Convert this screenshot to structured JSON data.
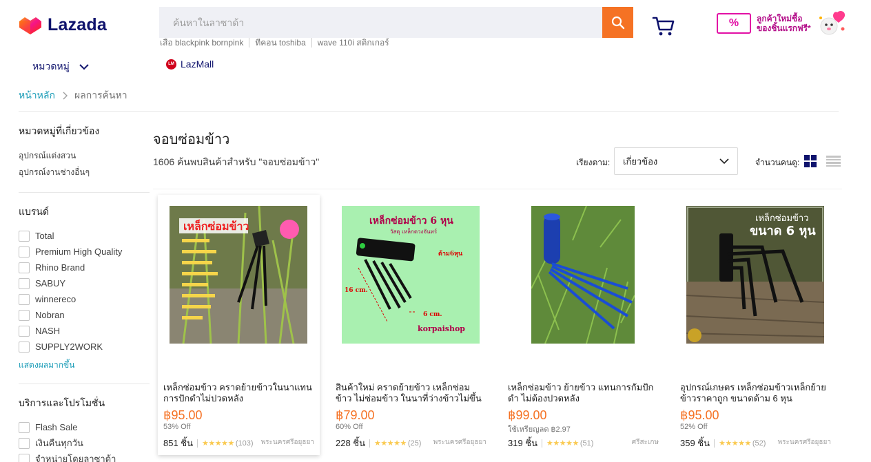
{
  "header": {
    "logo_text": "Lazada",
    "search_placeholder": "ค้นหาในลาซาด้า",
    "suggestions": [
      "เสือ blackpink bornpink",
      "ทีคอน toshiba",
      "wave 110i สติกเกอร์"
    ],
    "categories_label": "หมวดหมู่",
    "lazmall_label": "LazMall",
    "promo_text_line1": "ลูกค้าใหม่ซื้อ",
    "promo_text_line2": "ของชิ้นแรกฟรี*",
    "promo_symbol": "%"
  },
  "breadcrumb": {
    "home": "หน้าหลัก",
    "current": "ผลการค้นหา"
  },
  "sidebar": {
    "related_title": "หมวดหมู่ที่เกี่ยวข้อง",
    "related": [
      "อุปกรณ์แต่งสวน",
      "อุปกรณ์งานช่างอื่นๆ"
    ],
    "brand_title": "แบรนด์",
    "brands": [
      "Total",
      "Premium High Quality",
      "Rhino Brand",
      "SABUY",
      "winnereco",
      "Nobran",
      "NASH",
      "SUPPLY2WORK"
    ],
    "show_more": "แสดงผลมากขึ้น",
    "service_title": "บริการและโปรโมชั่น",
    "services": [
      "Flash Sale",
      "เงินคืนทุกวัน",
      "จำหน่ายโดยลาซาด้า"
    ]
  },
  "results": {
    "title": "จอบซ่อมข้าว",
    "count_text": "1606 ค้นพบสินค้าสำหรับ \"จอบซ่อมข้าว\"",
    "sort_label": "เรียงตาม:",
    "sort_value": "เกี่ยวข้อง",
    "view_label": "จำนวนคนดู:"
  },
  "products": [
    {
      "name": "เหล็กซ่อมข้าว คราดย้ายข้าวในนาแทนการปักดำไม่ปวดหลัง",
      "price": "฿95.00",
      "discount": "53% Off",
      "sold": "851 ชิ้น",
      "stars": "★★★★★",
      "reviews": "(103)",
      "location": "พระนครศรีอยุธยา",
      "image_caption": "เหล็กซ่อมข้าว"
    },
    {
      "name": "สินค้าใหม่ คราดย้ายข้าว เหล็กซ่อมข้าว ไม่ซ่อมข้าว ในนาที่ว่างข้าวไม่ขึ้นไม่ปวด...",
      "price": "฿79.00",
      "discount": "60% Off",
      "sold": "228 ชิ้น",
      "stars": "★★★★★",
      "reviews": "(25)",
      "location": "พระนครศรีอยุธยา",
      "image_caption": "เหล็กซ่อมข้าว 6 หุน",
      "image_labels": [
        "วัสดุ เหล็กดวงจันทร์",
        "ด้าม6หุน",
        "16 cm.",
        "6 cm.",
        "korpaishop"
      ]
    },
    {
      "name": "เหล็กซ่อมข้าว ย้ายข้าว แทนการกัมปักดำ ไม่ต้องปวดหลัง",
      "price": "฿99.00",
      "discount": "ใช้เหรียญลด ฿2.97",
      "sold": "319 ชิ้น",
      "stars": "★★★★★",
      "reviews": "(51)",
      "location": "ศรีสะเกษ"
    },
    {
      "name": "อุปกรณ์เกษตร เหล็กซ่อมข้าวเหล็กย้ายข้าวราคาถูก ขนาดด้าม 6 หุน",
      "price": "฿95.00",
      "discount": "52% Off",
      "sold": "359 ชิ้น",
      "stars": "★★★★★",
      "reviews": "(52)",
      "location": "พระนครศรีอยุธยา",
      "image_caption": "เหล็กซ่อมข้าว",
      "image_subcaption": "ขนาด 6 หุน"
    }
  ],
  "colors": {
    "brand": "#0f136d",
    "accent": "#f57224",
    "link": "#1a9cb7",
    "promo": "#e20fa5"
  }
}
